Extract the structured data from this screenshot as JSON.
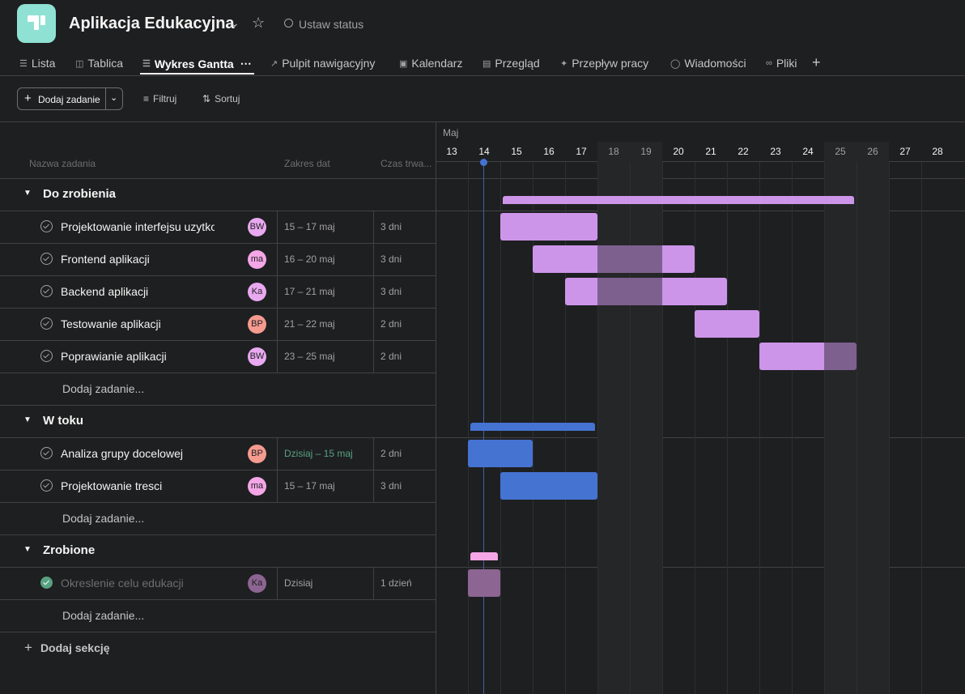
{
  "header": {
    "project_title": "Aplikacja Edukacyjna",
    "status_label": "Ustaw status"
  },
  "tabs": [
    {
      "label": "Lista",
      "icon": "list-icon"
    },
    {
      "label": "Tablica",
      "icon": "board-icon"
    },
    {
      "label": "Wykres Gantta",
      "icon": "gantt-icon",
      "active": true
    },
    {
      "label": "Pulpit nawigacyjny",
      "icon": "dashboard-icon"
    },
    {
      "label": "Kalendarz",
      "icon": "calendar-icon"
    },
    {
      "label": "Przegląd",
      "icon": "overview-icon"
    },
    {
      "label": "Przepływ pracy",
      "icon": "workflow-icon"
    },
    {
      "label": "Wiadomości",
      "icon": "messages-icon"
    },
    {
      "label": "Pliki",
      "icon": "files-icon"
    }
  ],
  "toolbar": {
    "add_task_label": "Dodaj zadanie",
    "filter_label": "Filtruj",
    "sort_label": "Sortuj"
  },
  "columns": {
    "name": "Nazwa zadania",
    "dates": "Zakres dat",
    "duration": "Czas trwa..."
  },
  "timeline": {
    "month": "Maj",
    "days": [
      "13",
      "14",
      "15",
      "16",
      "17",
      "18",
      "19",
      "20",
      "21",
      "22",
      "23",
      "24",
      "25",
      "26",
      "27",
      "28"
    ],
    "weekend_days": [
      "18",
      "19",
      "25",
      "26"
    ],
    "today": "14"
  },
  "sections": [
    {
      "name": "Do zrobienia",
      "color": "#cd95ea",
      "tasks": [
        {
          "name": "Projektowanie interfejsu uzytkownika",
          "assignee": "BW",
          "avatar_color": "#e8a9f0",
          "dates": "15 – 17 maj",
          "duration": "3 dni",
          "start": 15,
          "end": 17
        },
        {
          "name": "Frontend aplikacji",
          "assignee": "ma",
          "avatar_color": "#f4a6e6",
          "dates": "16 – 20 maj",
          "duration": "3 dni",
          "start": 16,
          "end": 20
        },
        {
          "name": "Backend aplikacji",
          "assignee": "Ka",
          "avatar_color": "#e8a9f0",
          "dates": "17 – 21 maj",
          "duration": "3 dni",
          "start": 17,
          "end": 21
        },
        {
          "name": "Testowanie aplikacji",
          "assignee": "BP",
          "avatar_color": "#f59a8f",
          "dates": "21 – 22 maj",
          "duration": "2 dni",
          "start": 21,
          "end": 22
        },
        {
          "name": "Poprawianie aplikacji",
          "assignee": "BW",
          "avatar_color": "#e8a9f0",
          "dates": "23 – 25 maj",
          "duration": "2 dni",
          "start": 23,
          "end": 25
        }
      ],
      "add_task_label": "Dodaj zadanie..."
    },
    {
      "name": "W toku",
      "color": "#4573d2",
      "tasks": [
        {
          "name": "Analiza grupy docelowej",
          "assignee": "BP",
          "avatar_color": "#f59a8f",
          "dates": "Dzisiaj – 15 maj",
          "duration": "2 dni",
          "start": 14,
          "end": 15,
          "today_date": true
        },
        {
          "name": "Projektowanie tresci",
          "assignee": "ma",
          "avatar_color": "#f4a6e6",
          "dates": "15 – 17 maj",
          "duration": "3 dni",
          "start": 15,
          "end": 17
        }
      ],
      "add_task_label": "Dodaj zadanie..."
    },
    {
      "name": "Zrobione",
      "color": "#f4a6e6",
      "tasks": [
        {
          "name": "Okreslenie celu edukacji",
          "assignee": "Ka",
          "avatar_color": "#8c6592",
          "dates": "Dzisiaj",
          "duration": "1 dzień",
          "start": 14,
          "end": 14,
          "completed": true
        }
      ],
      "add_task_label": "Dodaj zadanie..."
    }
  ],
  "add_section_label": "Dodaj sekcję"
}
